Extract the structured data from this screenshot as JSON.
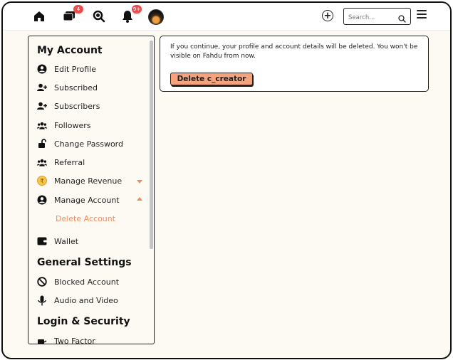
{
  "topbar": {
    "messages_badge": "4",
    "notifications_badge": "9+",
    "search_placeholder": "Search..."
  },
  "sidebar": {
    "sections": {
      "my_account": "My Account",
      "general_settings": "General Settings",
      "login_security": "Login & Security"
    },
    "items": {
      "edit_profile": "Edit Profile",
      "subscribed": "Subscribed",
      "subscribers": "Subscribers",
      "followers": "Followers",
      "change_password": "Change Password",
      "referral": "Referral",
      "manage_revenue": "Manage Revenue",
      "manage_account": "Manage Account",
      "delete_account": "Delete Account",
      "wallet": "Wallet",
      "blocked_account": "Blocked Account",
      "audio_video": "Audio and Video",
      "two_factor": "Two Factor"
    }
  },
  "main": {
    "message": "If you continue, your profile and account details will be deleted. You won't be visible on Fahdu from now.",
    "delete_button": "Delete c_creator"
  },
  "colors": {
    "accent": "#f28c5c",
    "button_bg": "#f5a27d",
    "badge": "#ef4b4b",
    "page_bg": "#fdfaf4"
  }
}
